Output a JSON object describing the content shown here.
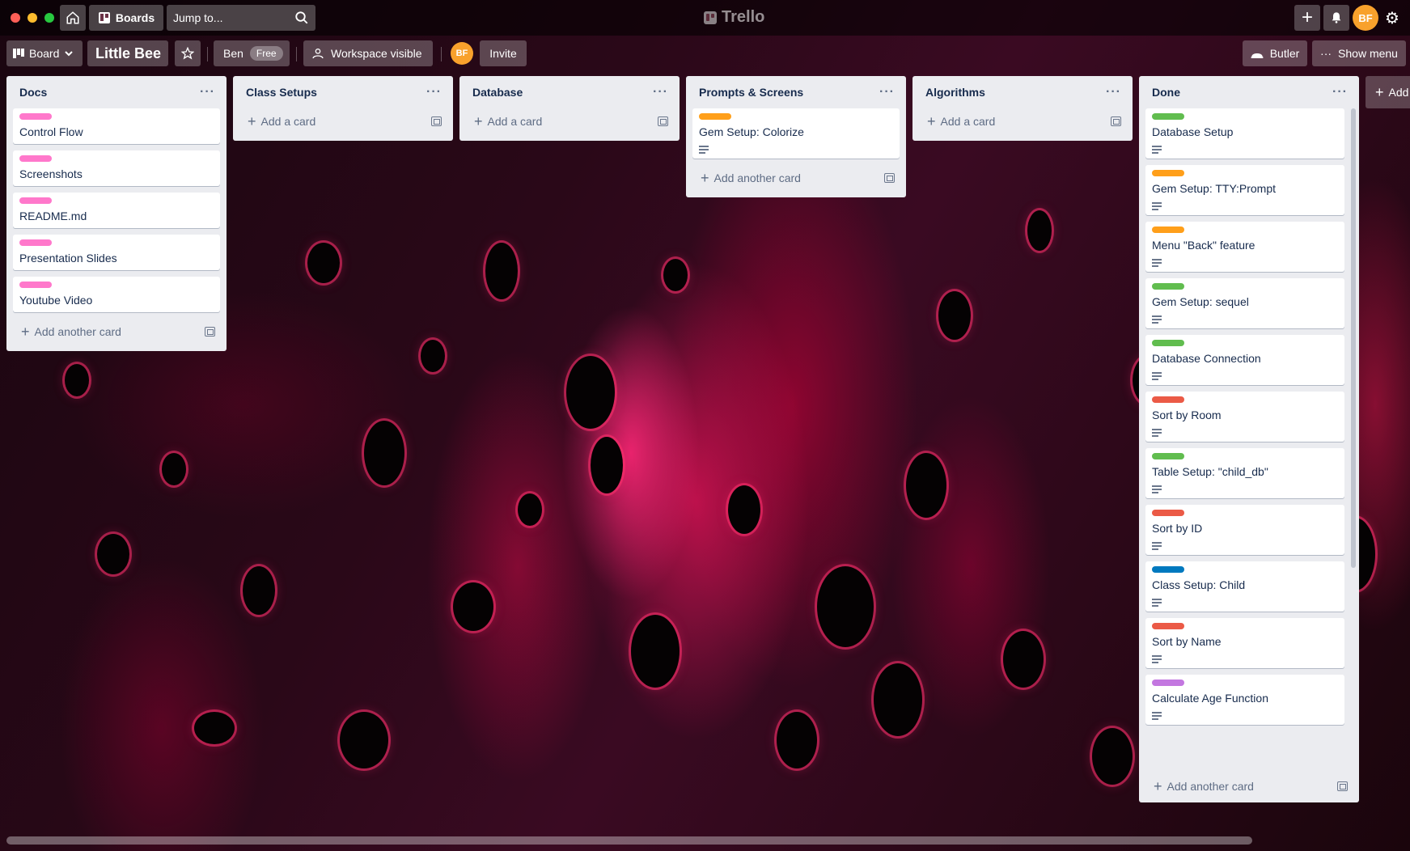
{
  "header": {
    "boards_label": "Boards",
    "jump_placeholder": "Jump to...",
    "app_name": "Trello",
    "user_initials": "BF"
  },
  "board_header": {
    "view_label": "Board",
    "board_title": "Little Bee",
    "workspace_name": "Ben",
    "plan_badge": "Free",
    "visibility_label": "Workspace visible",
    "member_initials": "BF",
    "invite_label": "Invite",
    "butler_label": "Butler",
    "show_menu_label": "Show menu"
  },
  "lists": [
    {
      "title": "Docs",
      "add_label": "Add another card",
      "cards": [
        {
          "title": "Control Flow",
          "label_color": "#ff78cb",
          "has_desc": false
        },
        {
          "title": "Screenshots",
          "label_color": "#ff78cb",
          "has_desc": false
        },
        {
          "title": "README.md",
          "label_color": "#ff78cb",
          "has_desc": false
        },
        {
          "title": "Presentation Slides",
          "label_color": "#ff78cb",
          "has_desc": false
        },
        {
          "title": "Youtube Video",
          "label_color": "#ff78cb",
          "has_desc": false
        }
      ]
    },
    {
      "title": "Class Setups",
      "add_label": "Add a card",
      "cards": []
    },
    {
      "title": "Database",
      "add_label": "Add a card",
      "cards": []
    },
    {
      "title": "Prompts & Screens",
      "add_label": "Add another card",
      "cards": [
        {
          "title": "Gem Setup: Colorize",
          "label_color": "#ff9f1a",
          "has_desc": true
        }
      ]
    },
    {
      "title": "Algorithms",
      "add_label": "Add a card",
      "cards": []
    },
    {
      "title": "Done",
      "add_label": "Add another card",
      "cards": [
        {
          "title": "Database Setup",
          "label_color": "#61bd4f",
          "has_desc": true
        },
        {
          "title": "Gem Setup: TTY:Prompt",
          "label_color": "#ff9f1a",
          "has_desc": true
        },
        {
          "title": "Menu \"Back\" feature",
          "label_color": "#ff9f1a",
          "has_desc": true
        },
        {
          "title": "Gem Setup: sequel",
          "label_color": "#61bd4f",
          "has_desc": true
        },
        {
          "title": "Database Connection",
          "label_color": "#61bd4f",
          "has_desc": true
        },
        {
          "title": "Sort by Room",
          "label_color": "#eb5a46",
          "has_desc": true
        },
        {
          "title": "Table Setup: \"child_db\"",
          "label_color": "#61bd4f",
          "has_desc": true
        },
        {
          "title": "Sort by ID",
          "label_color": "#eb5a46",
          "has_desc": true
        },
        {
          "title": "Class Setup: Child",
          "label_color": "#0079bf",
          "has_desc": true
        },
        {
          "title": "Sort by Name",
          "label_color": "#eb5a46",
          "has_desc": true
        },
        {
          "title": "Calculate Age Function",
          "label_color": "#c377e0",
          "has_desc": true
        }
      ]
    }
  ],
  "add_list_label": "Add another list"
}
